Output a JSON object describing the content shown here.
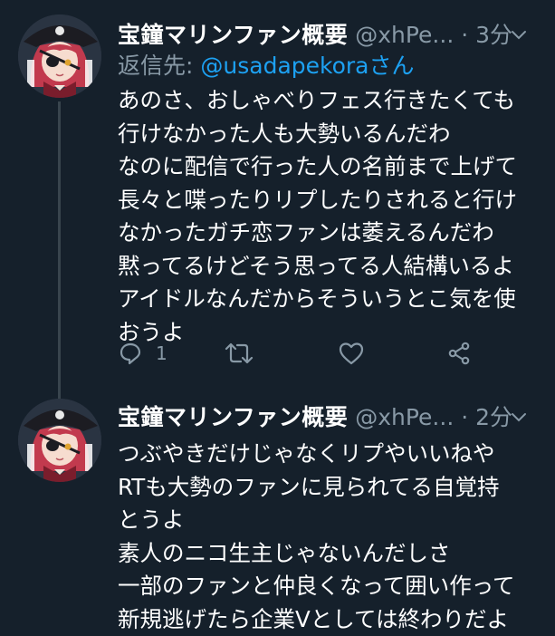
{
  "tweets": [
    {
      "display_name": "宝鐘マリンファン概要",
      "handle": "@xhPe...",
      "separator": "·",
      "time": "3分",
      "reply_prefix": "返信先:",
      "reply_mention": "@usadapekora",
      "reply_suffix": "さん",
      "text": "あのさ、おしゃべりフェス行きたくても\n行けなかった人も大勢いるんだわ\nなのに配信で行った人の名前まで上げて\n長々と喋ったりリプしたりされると行け\nなかったガチ恋ファンは萎えるんだわ\n黙ってるけどそう思ってる人結構いるよ\nアイドルなんだからそういうとこ気を使\nおうよ",
      "reply_count": "1",
      "icons": [
        "avatar",
        "chevron-down-icon",
        "reply-icon",
        "retweet-icon",
        "like-icon",
        "share-icon"
      ]
    },
    {
      "display_name": "宝鐘マリンファン概要",
      "handle": "@xhPe...",
      "separator": "·",
      "time": "2分",
      "text": "つぶやきだけじゃなくリプやいいねや\nRTも大勢のファンに見られてる自覚持\nとうよ\n素人のニコ生主じゃないんだしさ\n一部のファンと仲良くなって囲い作って\n新規逃げたら企業Vとしては終わりだよ",
      "icons": [
        "avatar",
        "chevron-down-icon"
      ]
    }
  ],
  "colors": {
    "background": "#15202b",
    "text": "#ffffff",
    "secondary_text": "#8899a6",
    "link": "#1da1f2",
    "thread_line": "#38444d"
  }
}
